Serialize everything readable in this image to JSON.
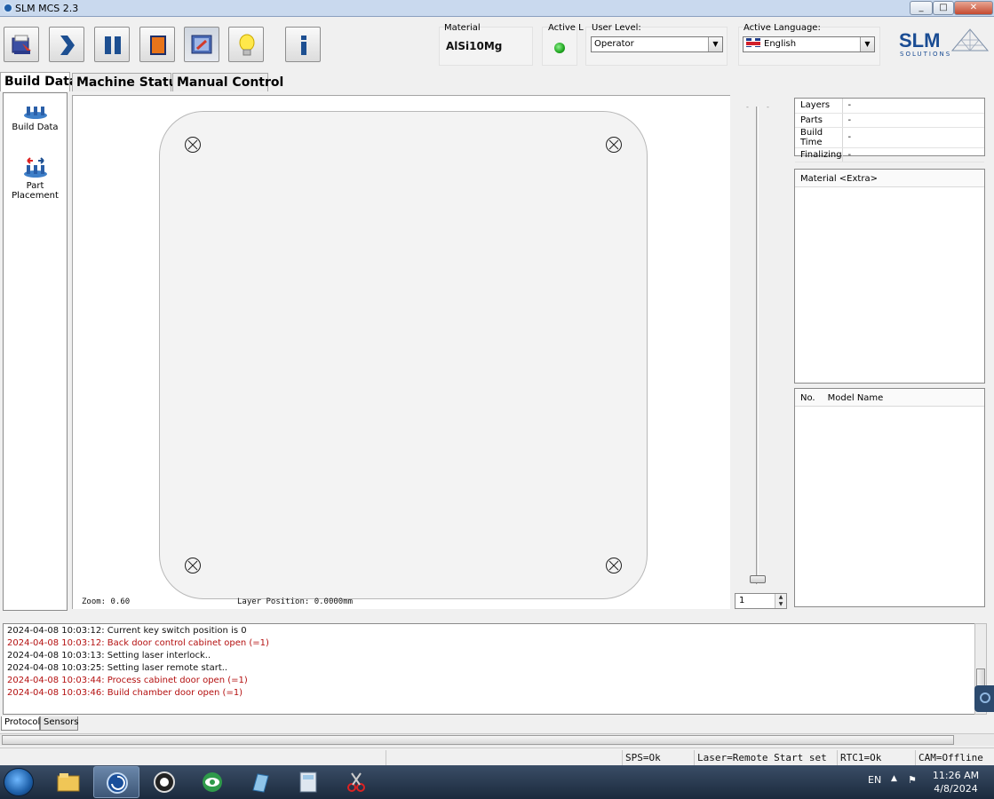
{
  "window": {
    "title": "SLM MCS 2.3",
    "min": "_",
    "max": "□",
    "close": "✕"
  },
  "toolbar": {
    "buttons": [
      {
        "name": "open-build-button",
        "icon": "folder-open-icon"
      },
      {
        "name": "start-button",
        "icon": "play-arrow-icon"
      },
      {
        "name": "pause-button",
        "icon": "pause-icon"
      },
      {
        "name": "stop-button",
        "icon": "stop-icon"
      },
      {
        "name": "screen-button",
        "icon": "monitor-icon"
      },
      {
        "name": "light-button",
        "icon": "lightbulb-icon"
      },
      {
        "name": "info-button",
        "icon": "info-icon"
      }
    ]
  },
  "material": {
    "label": "Material",
    "value": "AlSi10Mg"
  },
  "active_laser": {
    "label": "Active L",
    "status_color": "#1ea51e"
  },
  "user_level": {
    "label": "User Level:",
    "value": "Operator"
  },
  "language": {
    "label": "Active Language:",
    "value": "English"
  },
  "brand": {
    "name": "SLM",
    "sub": "SOLUTIONS"
  },
  "tabs": [
    "Build Data",
    "Machine Status",
    "Manual Control"
  ],
  "nav": [
    {
      "label": "Build Data",
      "icon": "build-data-icon"
    },
    {
      "label": "Part Placement",
      "icon": "part-placement-icon"
    }
  ],
  "canvas": {
    "zoom": "Zoom: 0.60",
    "layer_position": "Layer Position: 0.0000mm"
  },
  "layer_spinner": {
    "value": "1"
  },
  "info": [
    {
      "key": "Layers",
      "value": "-"
    },
    {
      "key": "Parts",
      "value": "-"
    },
    {
      "key": "Build Time",
      "value": "-"
    },
    {
      "key": "Finalizing",
      "value": "-"
    }
  ],
  "material_extra": {
    "header": "Material <Extra>"
  },
  "models": {
    "col_no": "No.",
    "col_name": "Model Name"
  },
  "log": [
    {
      "text": "2024-04-08 10:03:12: Current key switch position is 0",
      "level": "ok"
    },
    {
      "text": "2024-04-08 10:03:12: Back door control cabinet open (=1)",
      "level": "err"
    },
    {
      "text": "2024-04-08 10:03:13: Setting laser interlock..",
      "level": "ok"
    },
    {
      "text": "2024-04-08 10:03:25: Setting laser remote start..",
      "level": "ok"
    },
    {
      "text": "2024-04-08 10:03:44: Process cabinet door open (=1)",
      "level": "err"
    },
    {
      "text": "2024-04-08 10:03:46: Build chamber door open (=1)",
      "level": "err"
    }
  ],
  "log_tabs": [
    "Protocol",
    "Sensors"
  ],
  "status": {
    "sps": "SPS=Ok",
    "laser": "Laser=Remote Start set",
    "rtc": "RTC1=Ok",
    "cam": "CAM=Offline"
  },
  "taskbar": {
    "lang": "EN",
    "time": "11:26 AM",
    "date": "4/8/2024",
    "apps": [
      "explorer-icon",
      "slm-mcs-icon",
      "camera-icon",
      "eye-app-icon",
      "notes-app-icon",
      "calculator-icon",
      "snipping-tool-icon"
    ]
  }
}
